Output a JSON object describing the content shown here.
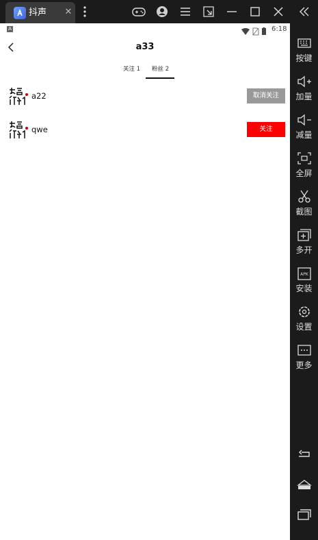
{
  "window": {
    "tab_title": "抖声",
    "tab_close": "✕"
  },
  "statusbar": {
    "left_icon": "A",
    "time": "6:18"
  },
  "header": {
    "title": "a33"
  },
  "tabs": [
    {
      "label": "关注 1",
      "active": false
    },
    {
      "label": "粉丝 2",
      "active": true
    }
  ],
  "users": [
    {
      "name": "a22",
      "button": "取消关注",
      "button_color": "#999999"
    },
    {
      "name": "qwe",
      "button": "关注",
      "button_color": "#ff0000"
    }
  ],
  "sidebar": {
    "items": [
      {
        "label": "按键",
        "icon": "keyboard-icon"
      },
      {
        "label": "加量",
        "icon": "volume-up-icon"
      },
      {
        "label": "减量",
        "icon": "volume-down-icon"
      },
      {
        "label": "全屏",
        "icon": "fullscreen-icon"
      },
      {
        "label": "截图",
        "icon": "scissors-icon"
      },
      {
        "label": "多开",
        "icon": "multi-instance-icon"
      },
      {
        "label": "安装",
        "icon": "apk-icon"
      },
      {
        "label": "设置",
        "icon": "gear-icon"
      },
      {
        "label": "更多",
        "icon": "more-icon"
      }
    ]
  },
  "colors": {
    "chrome_bg": "#1b1b1b",
    "tab_bg": "#3a3a3a",
    "unfollow_btn": "#999999",
    "follow_btn": "#ff0000"
  }
}
